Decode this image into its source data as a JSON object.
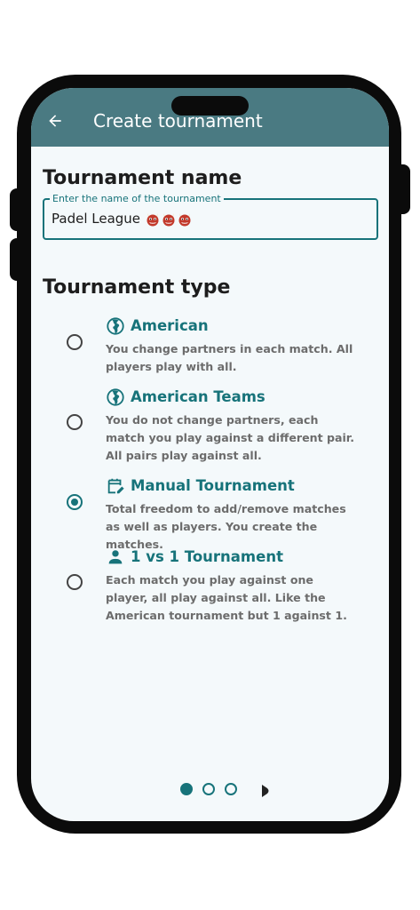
{
  "appbar": {
    "title": "Create tournament",
    "back_icon": "arrow-left-icon"
  },
  "name_section": {
    "title": "Tournament name",
    "field_label": "Enter the name of the tournament",
    "field_value": "Padel League",
    "emoji": [
      "👹",
      "👹",
      "👹"
    ]
  },
  "type_section": {
    "title": "Tournament type",
    "options": [
      {
        "title": "American",
        "icon": "globe-americas-icon",
        "description": "You change partners in each match. All players play with all.",
        "selected": false
      },
      {
        "title": "American Teams",
        "icon": "globe-americas-icon",
        "description": "You do not change partners, each match you play against a different pair. All pairs play against all.",
        "selected": false
      },
      {
        "title": "Manual Tournament",
        "icon": "calendar-edit-icon",
        "description": "Total freedom to add/remove matches as well as players. You create the matches.",
        "selected": true
      },
      {
        "title": "1 vs 1 Tournament",
        "icon": "person-icon",
        "description": "Each match you play against one player, all play against all. Like the American tournament but 1 against 1.",
        "selected": false
      }
    ]
  },
  "pager": {
    "page_count": 3,
    "current_page": 1,
    "next_icon": "chevron-right-icon"
  },
  "colors": {
    "appbar": "#4a7a82",
    "accent": "#17737a",
    "background": "#f4f9fb",
    "phone_frame": "#0b0b0b"
  }
}
